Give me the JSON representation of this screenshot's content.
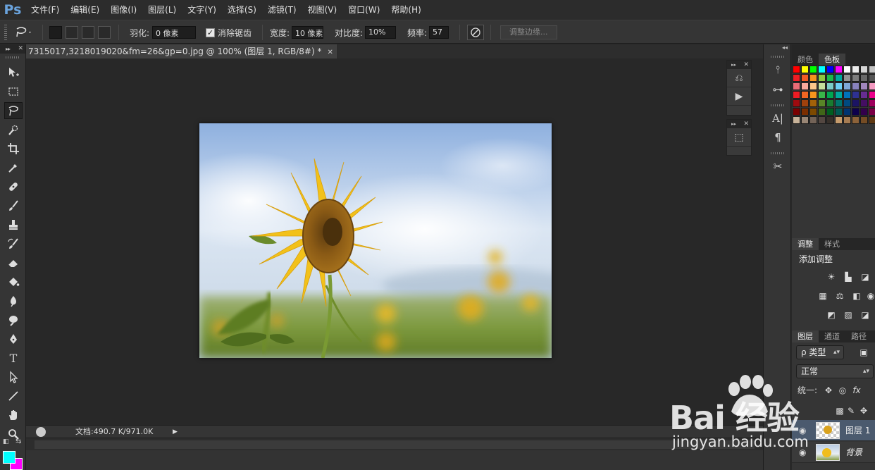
{
  "app": {
    "logo": "Ps"
  },
  "menu": [
    "文件(F)",
    "编辑(E)",
    "图像(I)",
    "图层(L)",
    "文字(Y)",
    "选择(S)",
    "滤镜(T)",
    "视图(V)",
    "窗口(W)",
    "帮助(H)"
  ],
  "options": {
    "feather_label": "羽化:",
    "feather_value": "0 像素",
    "antialias_label": "消除锯齿",
    "antialias_checked": true,
    "width_label": "宽度:",
    "width_value": "10 像素",
    "contrast_label": "对比度:",
    "contrast_value": "10%",
    "frequency_label": "频率:",
    "frequency_value": "57",
    "refine_edge_label": "调整边缘..."
  },
  "document": {
    "tab_title": "7315017,3218019020&fm=26&gp=0.jpg @ 100% (图层 1, RGB/8#) *",
    "status_text": "文档:490.7 K/971.0K"
  },
  "tools": [
    {
      "name": "move-tool",
      "icon": "move-icon"
    },
    {
      "name": "marquee-tool",
      "icon": "marquee-icon"
    },
    {
      "name": "lasso-tool",
      "icon": "magnetic-lasso-icon",
      "active": true
    },
    {
      "name": "quick-select-tool",
      "icon": "quick-select-icon"
    },
    {
      "name": "crop-tool",
      "icon": "crop-icon"
    },
    {
      "name": "eyedropper-tool",
      "icon": "eyedropper-icon"
    },
    {
      "name": "healing-brush-tool",
      "icon": "bandage-icon"
    },
    {
      "name": "brush-tool",
      "icon": "brush-icon"
    },
    {
      "name": "clone-stamp-tool",
      "icon": "stamp-icon"
    },
    {
      "name": "history-brush-tool",
      "icon": "history-brush-icon"
    },
    {
      "name": "eraser-tool",
      "icon": "eraser-icon"
    },
    {
      "name": "paint-bucket-tool",
      "icon": "bucket-icon"
    },
    {
      "name": "blur-tool",
      "icon": "blur-icon"
    },
    {
      "name": "dodge-tool",
      "icon": "dodge-icon"
    },
    {
      "name": "pen-tool",
      "icon": "pen-icon"
    },
    {
      "name": "type-tool",
      "icon": "type-icon"
    },
    {
      "name": "path-select-tool",
      "icon": "arrow-icon"
    },
    {
      "name": "line-tool",
      "icon": "line-icon"
    },
    {
      "name": "hand-tool",
      "icon": "hand-icon"
    },
    {
      "name": "zoom-tool",
      "icon": "zoom-icon"
    }
  ],
  "colors": {
    "foreground": "#00ffff",
    "background": "#ff00ff"
  },
  "panels": {
    "color_tabs": [
      "颜色",
      "色板"
    ],
    "adjust_tabs": [
      "调整",
      "样式"
    ],
    "adjust_title": "添加调整",
    "layer_tabs": [
      "图层",
      "通道",
      "路径"
    ],
    "layer_filter": "ρ 类型",
    "blend_mode": "正常",
    "unify_label": "统一:",
    "layers": [
      {
        "name": "图层 1",
        "selected": true
      },
      {
        "name": "背景",
        "selected": false,
        "italic": true
      }
    ]
  },
  "swatch_colors": [
    [
      "#ff0000",
      "#ffff00",
      "#00ff00",
      "#00ffff",
      "#0000ff",
      "#ff00ff",
      "#ffffff",
      "#ebebeb",
      "#d6d6d6",
      "#c2c2c2"
    ],
    [
      "#ee1d24",
      "#f15a24",
      "#f7941d",
      "#8dc63f",
      "#1ab94a",
      "#00a99d",
      "#949494",
      "#7d7d7d",
      "#686868",
      "#545454"
    ],
    [
      "#e96b76",
      "#f8a99b",
      "#fdc68a",
      "#c4df9b",
      "#7accc8",
      "#6ecff6",
      "#7ea7d8",
      "#8882be",
      "#a186be",
      "#f49ac1"
    ],
    [
      "#ed1c24",
      "#f26522",
      "#f7941d",
      "#39b54a",
      "#00a651",
      "#00a99d",
      "#0072bc",
      "#2e3192",
      "#662d91",
      "#ec008c"
    ],
    [
      "#9e0b0f",
      "#a0410d",
      "#a36209",
      "#598527",
      "#197b30",
      "#00746b",
      "#004a80",
      "#1b1464",
      "#440e62",
      "#9e005d"
    ],
    [
      "#790000",
      "#7b2e00",
      "#7d4900",
      "#406618",
      "#005e20",
      "#005952",
      "#003471",
      "#0d004c",
      "#32004b",
      "#7b0046"
    ],
    [
      "#c7b299",
      "#998675",
      "#736357",
      "#534741",
      "#37302a",
      "#c69c6d",
      "#a67c52",
      "#8c6239",
      "#754c24",
      "#603913"
    ]
  ],
  "watermark": {
    "main": "Bai 经验",
    "sub": "jingyan.baidu.com"
  }
}
